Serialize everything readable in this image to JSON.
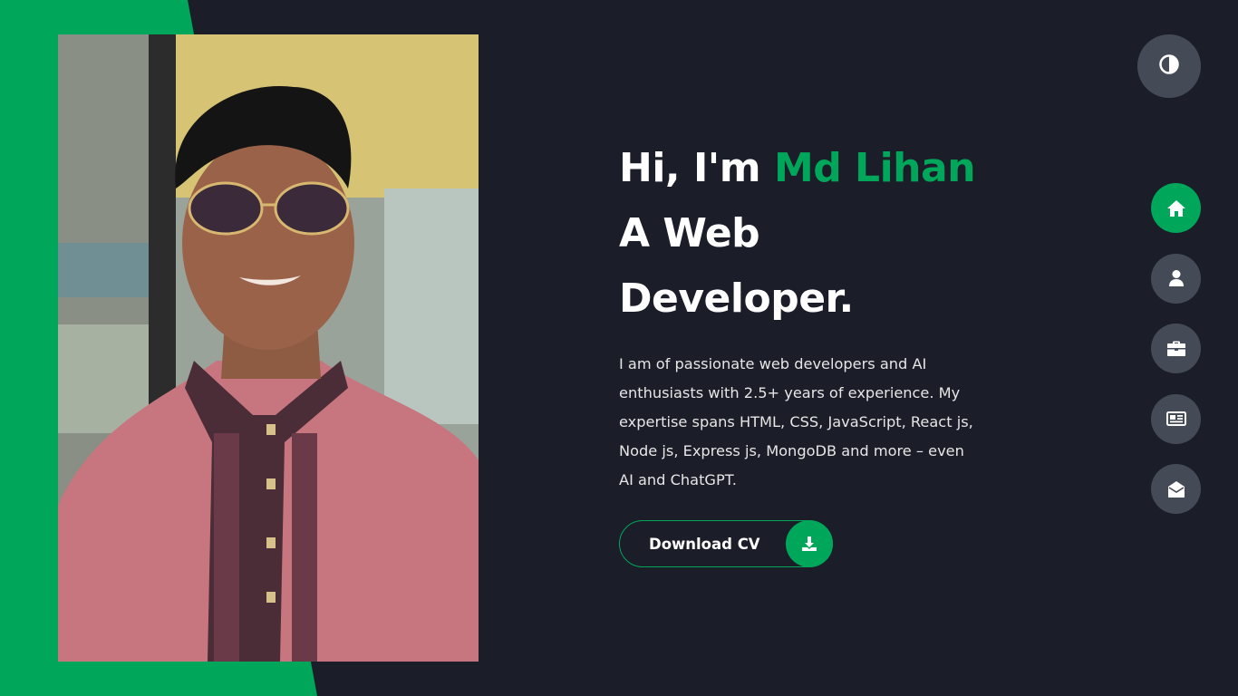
{
  "hero": {
    "greeting": "Hi, I'm ",
    "name": "Md Lihan",
    "role_line1": "A Web",
    "role_line2": "Developer.",
    "description": "I am of passionate web developers and AI enthusiasts with 2.5+ years of experience. My expertise spans HTML, CSS, JavaScript, React js, Node js, Express js, MongoDB and more – even AI and ChatGPT.",
    "cta_label": "Download CV",
    "cta_icon": "download-icon"
  },
  "photo": {
    "alt": "Md Lihan"
  },
  "theme_toggle": {
    "icon": "contrast-icon"
  },
  "nav": [
    {
      "icon": "home-icon",
      "active": true
    },
    {
      "icon": "user-icon",
      "active": false
    },
    {
      "icon": "briefcase-icon",
      "active": false
    },
    {
      "icon": "newspaper-icon",
      "active": false
    },
    {
      "icon": "envelope-open-icon",
      "active": false
    }
  ],
  "colors": {
    "accent": "#00a65a",
    "background": "#1b1e28",
    "nav_inactive": "#454b56",
    "text": "#ffffff"
  }
}
